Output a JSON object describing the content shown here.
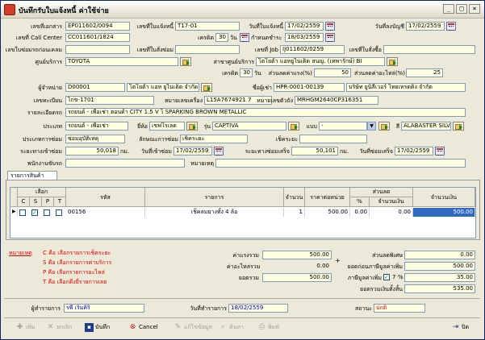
{
  "window": {
    "title": "บันทึกรับใบแจ้งหนี้ ค่าใช้จ่าย"
  },
  "header": {
    "doc_no_label": "เลขที่เอกสาร",
    "doc_no": "EP011602/0094",
    "invoice_no_label": "เลขที่ใบแจ้งหนี้",
    "invoice_no": "T17-01",
    "invoice_date_label": "วันที่ใบแจ้งหนี้",
    "invoice_date": "17/02/2559",
    "account_date_label": "วันที่ลงบัญชี",
    "account_date": "17/02/2559",
    "callcenter_label": "เลขที่ Call Center",
    "callcenter": "CC011601/1824",
    "credit_label": "เครดิต",
    "credit": "30",
    "credit_unit": "วัน",
    "due_label": "กำหนดชำระ",
    "due": "18/03/2559",
    "checkin_label": "เลขใบซ่อมรถก่อนเคลม",
    "repair_no_label": "เลขที่ใบสั่งซ่อม",
    "job_label": "เลขที่ Job",
    "job": "IJ011602/0259",
    "purchase_label": "เลขที่ใบสั่งซื้อ",
    "center_label": "ศูนย์บริการ",
    "center": "TOYOTA",
    "branch_label": "สาขาศูนย์บริการ",
    "branch": "โตโยต้า แอทยูไนเต็ด สนญ. (เทพารักษ์) BI",
    "credit2_label": "เครดิต",
    "credit2": "30",
    "credit2_unit": "วัน",
    "discount_label": "ส่วนลดค่าแรง(%)",
    "discount": "50",
    "discount_part_label": "ส่วนลดค่าอะไหล่(%)",
    "discount_part": "25",
    "vendor_label": "ผู้จำหน่าย",
    "vendor_code": "D00001",
    "vendor_name": "โตโยต้า แอท ยูไนเต็ด จำกัด",
    "lessee_label": "ชื่อผู้เช่า",
    "lessee_code": "HPR-0001-00139",
    "lessee_name": "บริษัท ยูนิลีเวอร์ ไทยเทรดดิ้ง จำกัด",
    "plate_label": "เลขทะเบียน",
    "plate": "ไกข-1701",
    "engine_label": "หมายเลขเครื่อง",
    "engine": "L15A7674921 7",
    "chassis_label": "หมายเลขตัวถัง",
    "chassis": "MRHGM2640CP316351",
    "detail_label": "รายละเอียดรถ",
    "detail": "รถยนต์ - เพื่อเช่า ฮอนด้า CITY 1.5 V ไ SPARKING BROWN METALLIC",
    "type_label": "ประเภท",
    "type": "รถยนต์ - เพื่อเช่า",
    "brand_label": "ยี่ห้อ",
    "brand": "เชฟโรเลต",
    "model_label": "รุ่น",
    "model": "CAPTIVA",
    "style_label": "แบบ",
    "style": "-",
    "color_label": "สี",
    "color": "ALABASTER SILV",
    "repair_type_label": "ประเภทการซ่อม",
    "repair_type": "ซ่อมอุบัติเหตุ",
    "repair_kind_label": "ลักษณะการซ่อม",
    "repair_kind": "เช็คระยะ",
    "claim_label": "เช็คระยะ",
    "mileage_in_label": "ระยะทางเข้าซ่อม",
    "mileage_in": "50,018",
    "km": "กม.",
    "date_in_label": "วันที่เข้าซ่อม",
    "date_in": "17/02/2559",
    "mileage_out_label": "ระยะทางซ่อมเสร็จ",
    "mileage_out": "50,101",
    "date_out_label": "วันที่ซ่อมเสร็จ",
    "date_out": "17/02/2559",
    "driver_label": "พนักงานขับรถ",
    "note_label": "หมายเหตุ"
  },
  "tabs": [
    {
      "label": "รายการสินค้า"
    }
  ],
  "grid": {
    "h_select": "เลือก",
    "h_c": "C",
    "h_s": "S",
    "h_p": "P",
    "h_t": "T",
    "h_code": "รหัส",
    "h_item": "รายการ",
    "h_qty": "จำนวน",
    "h_price": "ราคาต่อหน่วย",
    "h_discount": "ส่วนลด",
    "h_pct": "%",
    "h_amount": "จำนวนเงิน",
    "h_total": "จำนวนเงิน",
    "rows": [
      {
        "code": "00156",
        "item": "เช็คลมยางทั้ง 4 ล้อ",
        "qty": "1",
        "price": "500.00",
        "pct": "0.00",
        "disc": "0.00",
        "total": "500.00"
      }
    ]
  },
  "legend": {
    "title": "หมายเหตุ",
    "c": "C คือ เลือกรายการเช็คระยะ",
    "s": "S คือ เลือกรายการค่าบริการ",
    "p": "P คือ เลือกรายการอะไหล่",
    "t": "T คือ เลือกดึงยี่รายการเลย"
  },
  "totals": {
    "labor_label": "ค่าแรงรวม",
    "labor": "500.00",
    "parts_label": "ค่าอะไหล่รวม",
    "parts": "0.00",
    "sum_label": "ยอดรวม",
    "sum": "500.00",
    "special_disc_label": "ส่วนลดพิเศษ",
    "special_disc": "0.00",
    "before_vat_label": "ยอดก่อนภาษีมูลค่าเพิ่ม",
    "before_vat": "500.00",
    "vat_label": "ภาษีมูลค่าเพิ่ม",
    "vat_rate": "7",
    "vat_pct": "%",
    "vat": "35.00",
    "grand_label": "ยอดรวมเงินทั้งสิ้น",
    "grand": "535.00"
  },
  "footer": {
    "recorder_label": "ผู้ทำรายการ",
    "recorder": "รพี เริ่มคิริ",
    "date_label": "วันที่ทำรายการ",
    "date": "18/02/2559",
    "status_label": "สถานะ",
    "status": "ปกติ"
  },
  "toolbar": {
    "add": "เพิ่ม",
    "cancel_item": "ยกเลิก",
    "save": "บันทึก",
    "cancel": "Cancel",
    "edit": "แก้ไขข้อมูล",
    "search": "ค้นหา",
    "print": "พิมพ์",
    "close": "ปิด"
  }
}
